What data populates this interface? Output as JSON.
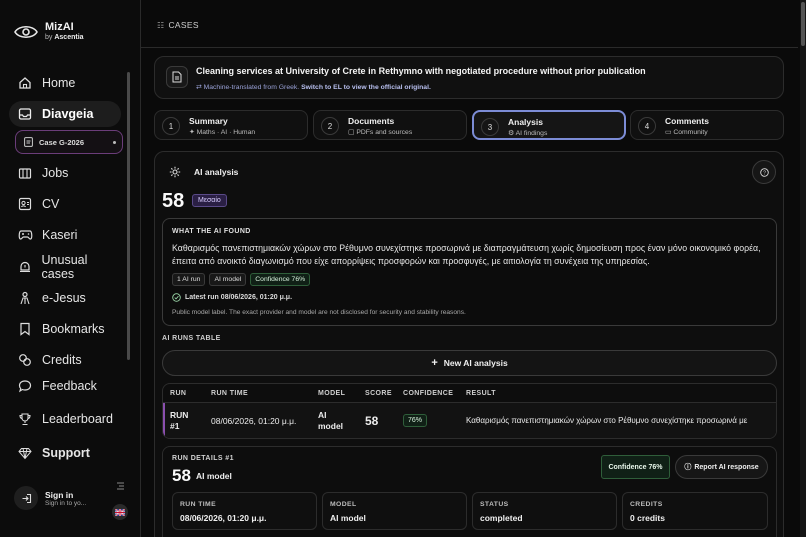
{
  "brand": {
    "name": "MizAI",
    "by_prefix": "by",
    "by_name": "Ascentia"
  },
  "sidebar": {
    "items": [
      {
        "label": "Home",
        "icon": "home-icon"
      },
      {
        "label": "Diavgeia",
        "icon": "inbox-icon",
        "active": true
      },
      {
        "label": "Jobs",
        "icon": "building-icon"
      },
      {
        "label": "CV",
        "icon": "id-card-icon"
      },
      {
        "label": "Kaseri",
        "icon": "gamepad-icon"
      },
      {
        "label": "Unusual cases",
        "icon": "alert-bell-icon"
      },
      {
        "label": "e-Jesus",
        "icon": "person-icon"
      },
      {
        "label": "Bookmarks",
        "icon": "bookmark-icon"
      },
      {
        "label": "Credits",
        "icon": "coins-icon"
      },
      {
        "label": "Feedback",
        "icon": "chat-bubble-icon"
      },
      {
        "label": "Leaderboard",
        "icon": "trophy-icon"
      },
      {
        "label": "Support",
        "icon": "gem-icon"
      }
    ],
    "case_pill": "Case G-2026",
    "signin": {
      "title": "Sign in",
      "subtitle": "Sign in to yo..."
    }
  },
  "breadcrumb": {
    "label": "CASES"
  },
  "header": {
    "title": "Cleaning services at University of Crete in Rethymno with negotiated procedure without prior publication",
    "sub_prefix": "Machine-translated from Greek.",
    "sub_link": "Switch to EL to view the official original."
  },
  "steps": [
    {
      "num": "1",
      "title": "Summary",
      "sub": "Maths · AI · Human"
    },
    {
      "num": "2",
      "title": "Documents",
      "sub": "PDFs and sources"
    },
    {
      "num": "3",
      "title": "Analysis",
      "sub": "AI findings",
      "active": true
    },
    {
      "num": "4",
      "title": "Comments",
      "sub": "Community"
    }
  ],
  "analysis": {
    "title": "AI analysis",
    "score": "58",
    "level": "Μεσαίο",
    "found_label": "WHAT THE AI FOUND",
    "found_text": "Καθαρισμός πανεπιστημιακών χώρων στο Ρέθυμνο συνεχίστηκε προσωρινά με διαπραγμάτευση χωρίς δημοσίευση προς έναν μόνο οικονομικό φορέα, έπειτα από ανοικτό διαγωνισμό που είχε απορρίψεις προσφορών και προσφυγές, με αιτιολογία τη συνέχεια της υπηρεσίας.",
    "chips": [
      "1 AI run",
      "AI model",
      "Confidence 76%"
    ],
    "latest_prefix": "Latest run",
    "latest_time": "08/06/2026, 01:20 μ.μ.",
    "note": "Public model label. The exact provider and model are not disclosed for security and stability reasons."
  },
  "runs": {
    "label": "AI RUNS TABLE",
    "new_button": "New AI analysis",
    "headers": [
      "RUN",
      "RUN TIME",
      "MODEL",
      "SCORE",
      "CONFIDENCE",
      "RESULT"
    ],
    "rows": [
      {
        "run_line1": "RUN",
        "run_line2": "#1",
        "time": "08/06/2026, 01:20 μ.μ.",
        "model_line1": "AI",
        "model_line2": "model",
        "score": "58",
        "confidence": "76%",
        "result": "Καθαρισμός πανεπιστημιακών χώρων στο Ρέθυμνο συνεχίστηκε προσωρινά με"
      }
    ]
  },
  "details": {
    "label": "RUN DETAILS #1",
    "score": "58",
    "model": "AI model",
    "confidence_button": "Confidence 76%",
    "report_button": "Report AI response",
    "cells": [
      {
        "key": "RUN TIME",
        "value": "08/06/2026, 01:20 μ.μ."
      },
      {
        "key": "MODEL",
        "value": "AI model"
      },
      {
        "key": "STATUS",
        "value": "completed"
      },
      {
        "key": "CREDITS",
        "value": "0 credits"
      }
    ]
  }
}
